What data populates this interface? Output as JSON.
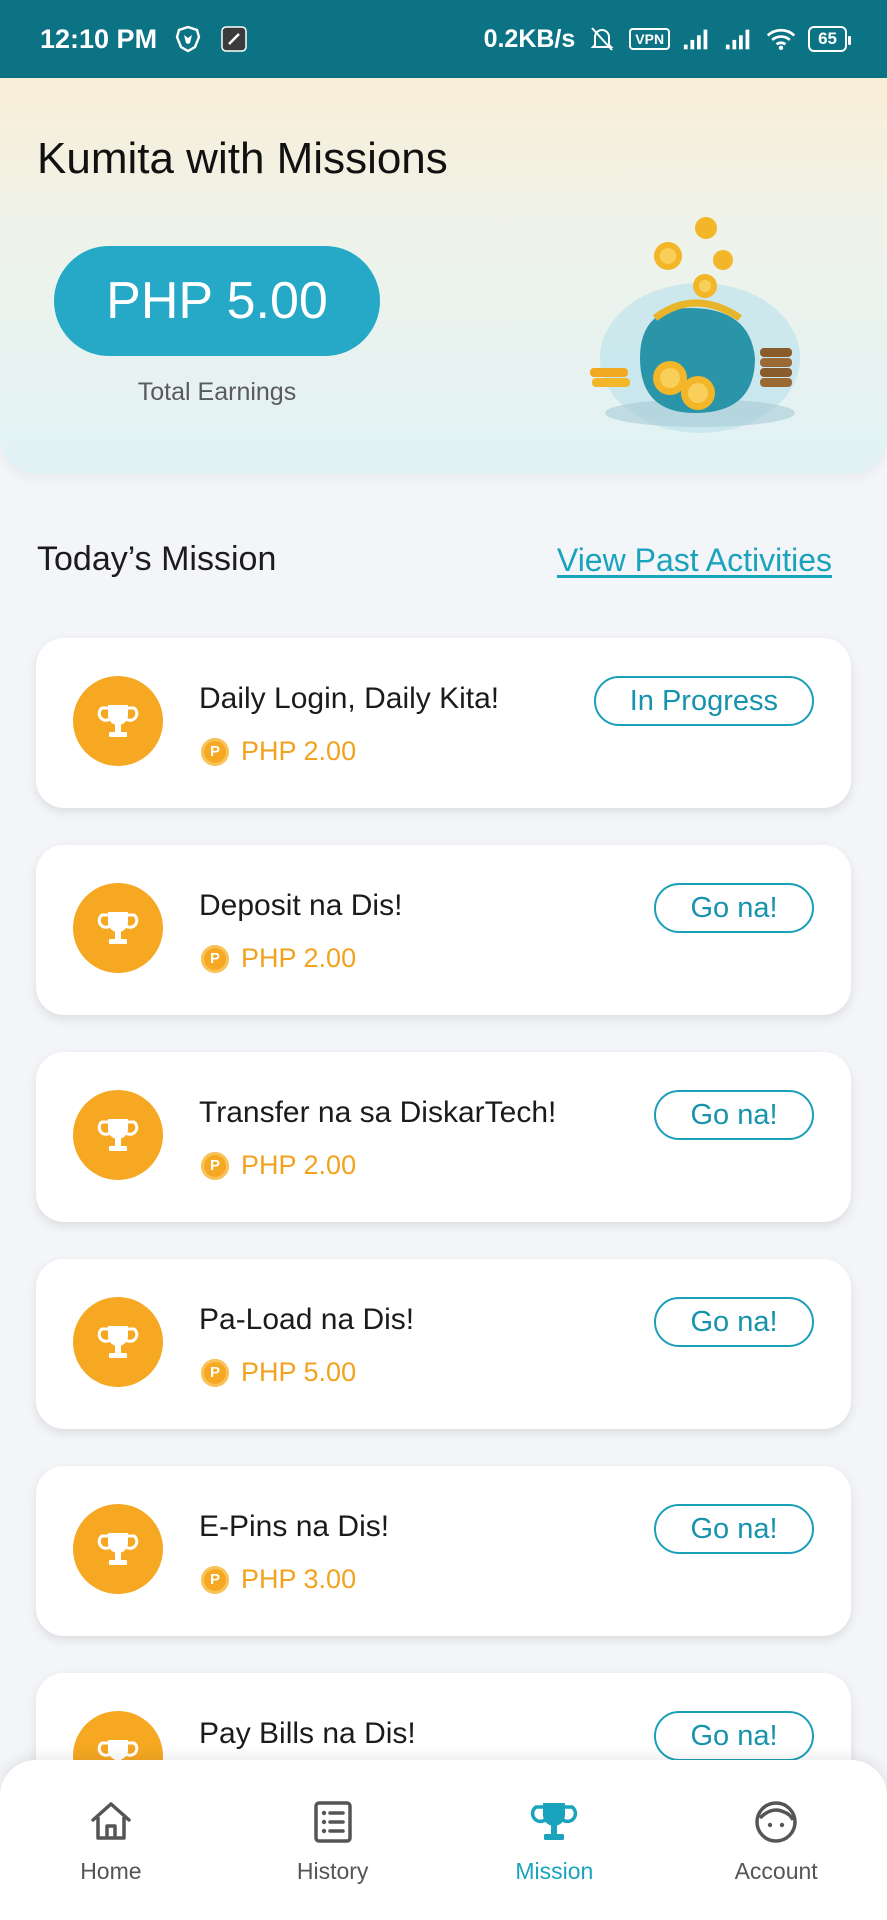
{
  "status_bar": {
    "time": "12:10 PM",
    "network_speed": "0.2KB/s",
    "vpn_label": "VPN",
    "battery": "65",
    "icons": [
      "brave-icon",
      "app-icon",
      "mute-bell-icon",
      "signal-icon",
      "signal-icon",
      "wifi-icon",
      "battery-icon"
    ]
  },
  "header": {
    "title": "Kumita with Missions",
    "earnings_amount": "PHP 5.00",
    "earnings_label": "Total Earnings"
  },
  "section": {
    "title": "Today’s Mission",
    "view_past_link": "View Past Activities"
  },
  "missions": [
    {
      "name": "Daily Login, Daily Kita!",
      "reward": "PHP 2.00",
      "action": "In Progress"
    },
    {
      "name": "Deposit na Dis!",
      "reward": "PHP 2.00",
      "action": "Go na!"
    },
    {
      "name": "Transfer na sa DiskarTech!",
      "reward": "PHP 2.00",
      "action": "Go na!"
    },
    {
      "name": "Pa-Load na Dis!",
      "reward": "PHP 5.00",
      "action": "Go na!"
    },
    {
      "name": "E-Pins na Dis!",
      "reward": "PHP 3.00",
      "action": "Go na!"
    },
    {
      "name": "Pay Bills na Dis!",
      "reward": "",
      "action": "Go na!"
    }
  ],
  "coin_symbol": "P",
  "bottom_nav": [
    {
      "label": "Home",
      "icon": "home-icon",
      "active": false
    },
    {
      "label": "History",
      "icon": "history-icon",
      "active": false
    },
    {
      "label": "Mission",
      "icon": "trophy-icon",
      "active": true
    },
    {
      "label": "Account",
      "icon": "account-icon",
      "active": false
    }
  ],
  "colors": {
    "status_bar": "#0c7385",
    "accent": "#26a9c6",
    "reward": "#f2a21e",
    "trophy_bg": "#f6a822"
  }
}
